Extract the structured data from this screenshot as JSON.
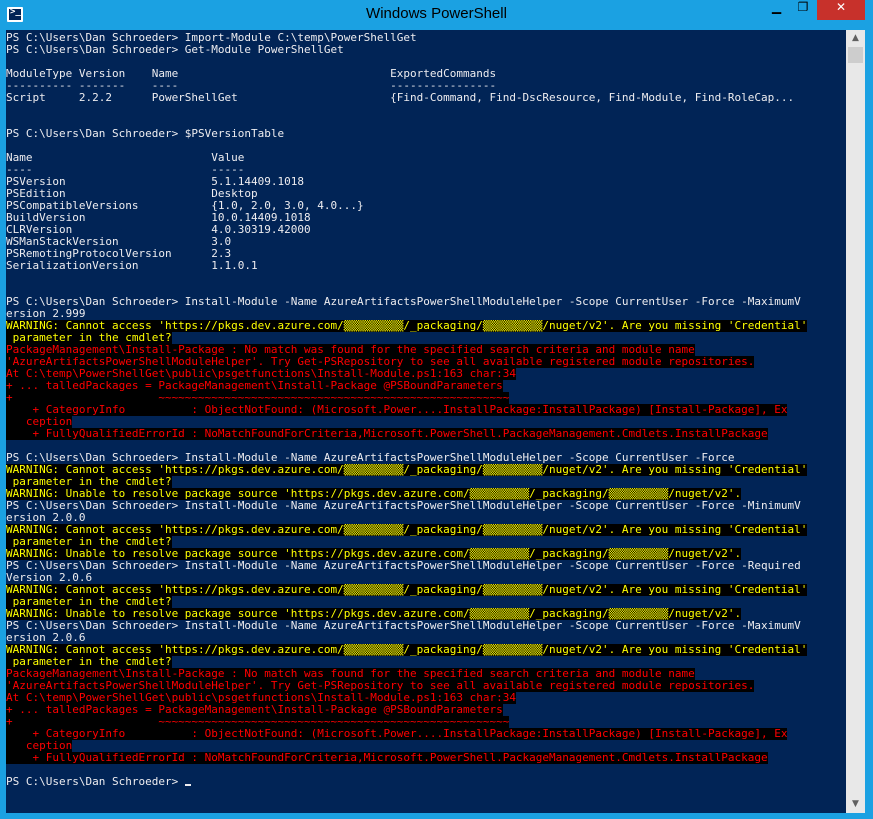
{
  "window": {
    "title": "Windows PowerShell",
    "controls": {
      "minimize": "▁",
      "maximize": "❐",
      "close": "✕"
    }
  },
  "console": {
    "lines": [
      {
        "t": "n",
        "s": "PS C:\\Users\\Dan Schroeder> Import-Module C:\\temp\\PowerShellGet"
      },
      {
        "t": "n",
        "s": "PS C:\\Users\\Dan Schroeder> Get-Module PowerShellGet"
      },
      {
        "t": "n",
        "s": ""
      },
      {
        "t": "n",
        "s": "ModuleType Version    Name                                ExportedCommands"
      },
      {
        "t": "n",
        "s": "---------- -------    ----                                ----------------"
      },
      {
        "t": "n",
        "s": "Script     2.2.2      PowerShellGet                       {Find-Command, Find-DscResource, Find-Module, Find-RoleCap..."
      },
      {
        "t": "n",
        "s": ""
      },
      {
        "t": "n",
        "s": ""
      },
      {
        "t": "n",
        "s": "PS C:\\Users\\Dan Schroeder> $PSVersionTable"
      },
      {
        "t": "n",
        "s": ""
      },
      {
        "t": "n",
        "s": "Name                           Value"
      },
      {
        "t": "n",
        "s": "----                           -----"
      },
      {
        "t": "n",
        "s": "PSVersion                      5.1.14409.1018"
      },
      {
        "t": "n",
        "s": "PSEdition                      Desktop"
      },
      {
        "t": "n",
        "s": "PSCompatibleVersions           {1.0, 2.0, 3.0, 4.0...}"
      },
      {
        "t": "n",
        "s": "BuildVersion                   10.0.14409.1018"
      },
      {
        "t": "n",
        "s": "CLRVersion                     4.0.30319.42000"
      },
      {
        "t": "n",
        "s": "WSManStackVersion              3.0"
      },
      {
        "t": "n",
        "s": "PSRemotingProtocolVersion      2.3"
      },
      {
        "t": "n",
        "s": "SerializationVersion           1.1.0.1"
      },
      {
        "t": "n",
        "s": ""
      },
      {
        "t": "n",
        "s": ""
      },
      {
        "t": "n",
        "s": "PS C:\\Users\\Dan Schroeder> Install-Module -Name AzureArtifactsPowerShellModuleHelper -Scope CurrentUser -Force -MaximumV"
      },
      {
        "t": "n",
        "s": "ersion 2.999"
      },
      {
        "t": "w",
        "s": "WARNING: Cannot access 'https://pkgs.dev.azure.com/▒▒▒▒▒▒▒▒▒/_packaging/▒▒▒▒▒▒▒▒▒/nuget/v2'. Are you missing 'Credential'"
      },
      {
        "t": "w",
        "s": " parameter in the cmdlet?"
      },
      {
        "t": "e",
        "s": "PackageManagement\\Install-Package : No match was found for the specified search criteria and module name"
      },
      {
        "t": "e",
        "s": "'AzureArtifactsPowerShellModuleHelper'. Try Get-PSRepository to see all available registered module repositories."
      },
      {
        "t": "e",
        "s": "At C:\\temp\\PowerShellGet\\public\\psgetfunctions\\Install-Module.ps1:163 char:34"
      },
      {
        "t": "e",
        "s": "+ ... talledPackages = PackageManagement\\Install-Package @PSBoundParameters"
      },
      {
        "t": "e",
        "s": "+                      ~~~~~~~~~~~~~~~~~~~~~~~~~~~~~~~~~~~~~~~~~~~~~~~~~~~~~"
      },
      {
        "t": "e",
        "s": "    + CategoryInfo          : ObjectNotFound: (Microsoft.Power....InstallPackage:InstallPackage) [Install-Package], Ex"
      },
      {
        "t": "e",
        "s": "   ception"
      },
      {
        "t": "e",
        "s": "    + FullyQualifiedErrorId : NoMatchFoundForCriteria,Microsoft.PowerShell.PackageManagement.Cmdlets.InstallPackage"
      },
      {
        "t": "n",
        "s": ""
      },
      {
        "t": "n",
        "s": "PS C:\\Users\\Dan Schroeder> Install-Module -Name AzureArtifactsPowerShellModuleHelper -Scope CurrentUser -Force"
      },
      {
        "t": "w",
        "s": "WARNING: Cannot access 'https://pkgs.dev.azure.com/▒▒▒▒▒▒▒▒▒/_packaging/▒▒▒▒▒▒▒▒▒/nuget/v2'. Are you missing 'Credential'"
      },
      {
        "t": "w",
        "s": " parameter in the cmdlet?"
      },
      {
        "t": "w",
        "s": "WARNING: Unable to resolve package source 'https://pkgs.dev.azure.com/▒▒▒▒▒▒▒▒▒/_packaging/▒▒▒▒▒▒▒▒▒/nuget/v2'."
      },
      {
        "t": "n",
        "s": "PS C:\\Users\\Dan Schroeder> Install-Module -Name AzureArtifactsPowerShellModuleHelper -Scope CurrentUser -Force -MinimumV"
      },
      {
        "t": "n",
        "s": "ersion 2.0.0"
      },
      {
        "t": "w",
        "s": "WARNING: Cannot access 'https://pkgs.dev.azure.com/▒▒▒▒▒▒▒▒▒/_packaging/▒▒▒▒▒▒▒▒▒/nuget/v2'. Are you missing 'Credential'"
      },
      {
        "t": "w",
        "s": " parameter in the cmdlet?"
      },
      {
        "t": "w",
        "s": "WARNING: Unable to resolve package source 'https://pkgs.dev.azure.com/▒▒▒▒▒▒▒▒▒/_packaging/▒▒▒▒▒▒▒▒▒/nuget/v2'."
      },
      {
        "t": "n",
        "s": "PS C:\\Users\\Dan Schroeder> Install-Module -Name AzureArtifactsPowerShellModuleHelper -Scope CurrentUser -Force -Required"
      },
      {
        "t": "n",
        "s": "Version 2.0.6"
      },
      {
        "t": "w",
        "s": "WARNING: Cannot access 'https://pkgs.dev.azure.com/▒▒▒▒▒▒▒▒▒/_packaging/▒▒▒▒▒▒▒▒▒/nuget/v2'. Are you missing 'Credential'"
      },
      {
        "t": "w",
        "s": " parameter in the cmdlet?"
      },
      {
        "t": "w",
        "s": "WARNING: Unable to resolve package source 'https://pkgs.dev.azure.com/▒▒▒▒▒▒▒▒▒/_packaging/▒▒▒▒▒▒▒▒▒/nuget/v2'."
      },
      {
        "t": "n",
        "s": "PS C:\\Users\\Dan Schroeder> Install-Module -Name AzureArtifactsPowerShellModuleHelper -Scope CurrentUser -Force -MaximumV"
      },
      {
        "t": "n",
        "s": "ersion 2.0.6"
      },
      {
        "t": "w",
        "s": "WARNING: Cannot access 'https://pkgs.dev.azure.com/▒▒▒▒▒▒▒▒▒/_packaging/▒▒▒▒▒▒▒▒▒/nuget/v2'. Are you missing 'Credential'"
      },
      {
        "t": "w",
        "s": " parameter in the cmdlet?"
      },
      {
        "t": "e",
        "s": "PackageManagement\\Install-Package : No match was found for the specified search criteria and module name"
      },
      {
        "t": "e",
        "s": "'AzureArtifactsPowerShellModuleHelper'. Try Get-PSRepository to see all available registered module repositories."
      },
      {
        "t": "e",
        "s": "At C:\\temp\\PowerShellGet\\public\\psgetfunctions\\Install-Module.ps1:163 char:34"
      },
      {
        "t": "e",
        "s": "+ ... talledPackages = PackageManagement\\Install-Package @PSBoundParameters"
      },
      {
        "t": "e",
        "s": "+                      ~~~~~~~~~~~~~~~~~~~~~~~~~~~~~~~~~~~~~~~~~~~~~~~~~~~~~"
      },
      {
        "t": "e",
        "s": "    + CategoryInfo          : ObjectNotFound: (Microsoft.Power....InstallPackage:InstallPackage) [Install-Package], Ex"
      },
      {
        "t": "e",
        "s": "   ception"
      },
      {
        "t": "e",
        "s": "    + FullyQualifiedErrorId : NoMatchFoundForCriteria,Microsoft.PowerShell.PackageManagement.Cmdlets.InstallPackage"
      },
      {
        "t": "n",
        "s": ""
      },
      {
        "t": "p",
        "s": "PS C:\\Users\\Dan Schroeder> "
      }
    ]
  },
  "colors": {
    "console_bg": "#012456",
    "text": "#eeedf0",
    "warning": "#ffff00",
    "error": "#ff0000",
    "chrome": "#1ba1e2",
    "close": "#c7312b"
  },
  "icons": {
    "app": "powershell-icon",
    "scroll_up": "▲",
    "scroll_down": "▼"
  }
}
